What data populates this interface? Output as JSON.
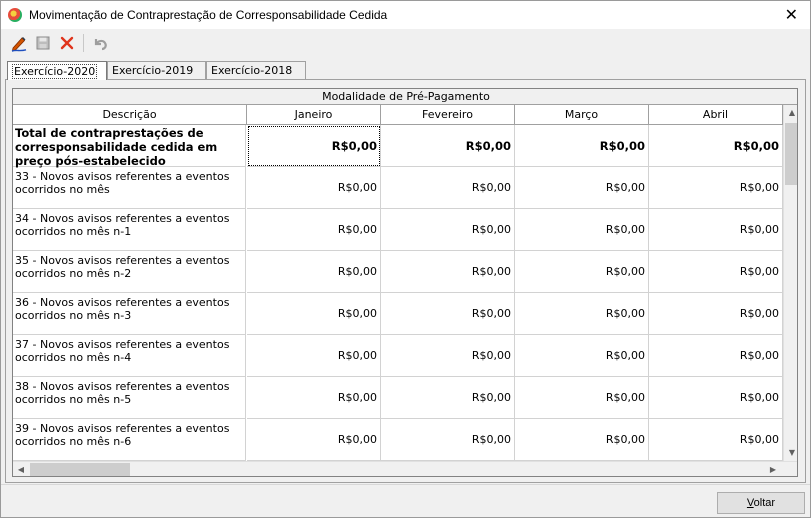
{
  "window": {
    "title": "Movimentação de Contraprestação de Corresponsabilidade Cedida",
    "close": "✕"
  },
  "toolbar": {
    "icons": [
      "edit-icon",
      "save-icon",
      "delete-icon",
      "undo-icon"
    ]
  },
  "tabs": [
    {
      "label": "Exercício-2020",
      "active": true
    },
    {
      "label": "Exercício-2019",
      "active": false
    },
    {
      "label": "Exercício-2018",
      "active": false
    }
  ],
  "grid": {
    "group_header": "Modalidade de Pré-Pagamento",
    "columns": [
      "Descrição",
      "Janeiro",
      "Fevereiro",
      "Março",
      "Abril"
    ],
    "rows": [
      {
        "desc": "Total de contraprestações de corresponsabilidade cedida em preço pós-estabelecido",
        "values": [
          "R$0,00",
          "R$0,00",
          "R$0,00",
          "R$0,00"
        ],
        "bold": true
      },
      {
        "desc": "33 - Novos avisos referentes a eventos ocorridos no mês",
        "values": [
          "R$0,00",
          "R$0,00",
          "R$0,00",
          "R$0,00"
        ]
      },
      {
        "desc": "34 - Novos avisos referentes a eventos ocorridos no mês n-1",
        "values": [
          "R$0,00",
          "R$0,00",
          "R$0,00",
          "R$0,00"
        ]
      },
      {
        "desc": "35 - Novos avisos referentes a eventos ocorridos no mês n-2",
        "values": [
          "R$0,00",
          "R$0,00",
          "R$0,00",
          "R$0,00"
        ]
      },
      {
        "desc": "36 - Novos avisos referentes a eventos ocorridos no mês n-3",
        "values": [
          "R$0,00",
          "R$0,00",
          "R$0,00",
          "R$0,00"
        ]
      },
      {
        "desc": "37 - Novos avisos referentes a eventos ocorridos no mês n-4",
        "values": [
          "R$0,00",
          "R$0,00",
          "R$0,00",
          "R$0,00"
        ]
      },
      {
        "desc": "38 - Novos avisos referentes a eventos ocorridos no mês n-5",
        "values": [
          "R$0,00",
          "R$0,00",
          "R$0,00",
          "R$0,00"
        ]
      },
      {
        "desc": "39 - Novos avisos referentes a eventos ocorridos no mês n-6",
        "values": [
          "R$0,00",
          "R$0,00",
          "R$0,00",
          "R$0,00"
        ]
      }
    ]
  },
  "footer": {
    "voltar_accel": "V",
    "voltar_rest": "oltar"
  }
}
